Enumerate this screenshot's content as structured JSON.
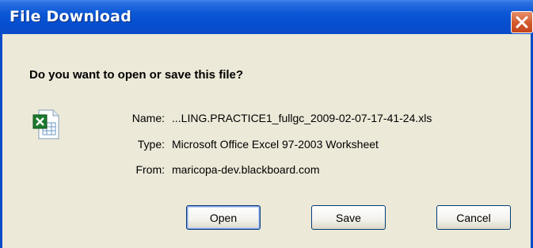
{
  "dialog": {
    "title": "File Download",
    "question": "Do you want to open or save this file?",
    "file": {
      "icon": "excel-file-icon",
      "name_label": "Name:",
      "name_value": "...LING.PRACTICE1_fullgc_2009-02-07-17-41-24.xls",
      "type_label": "Type:",
      "type_value": "Microsoft Office Excel 97-2003 Worksheet",
      "from_label": "From:",
      "from_value": "maricopa-dev.blackboard.com"
    },
    "buttons": {
      "open": "Open",
      "save": "Save",
      "cancel": "Cancel"
    }
  }
}
